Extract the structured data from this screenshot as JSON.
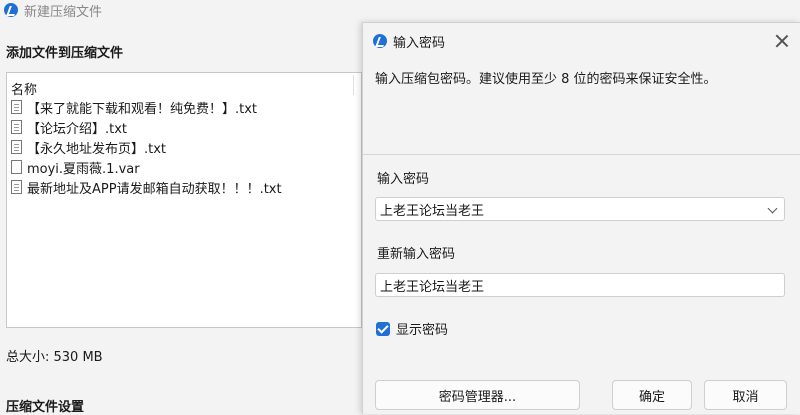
{
  "background_window": {
    "title": "新建压缩文件",
    "heading": "添加文件到压缩文件",
    "list_header": "名称",
    "files": [
      {
        "name": "【来了就能下载和观看！纯免费！】.txt",
        "icon": "text-file-icon"
      },
      {
        "name": "【论坛介绍】.txt",
        "icon": "text-file-icon"
      },
      {
        "name": "【永久地址发布页】.txt",
        "icon": "text-file-icon"
      },
      {
        "name": "moyi.夏雨薇.1.var",
        "icon": "blank-file-icon"
      },
      {
        "name": "最新地址及APP请发邮箱自动获取！！！.txt",
        "icon": "text-file-icon"
      }
    ],
    "total_size": "总大小: 530 MB",
    "settings_heading": "压缩文件设置"
  },
  "dialog": {
    "title": "输入密码",
    "description": "输入压缩包密码。建议使用至少 8 位的密码来保证安全性。",
    "password_label": "输入密码",
    "password_value": "上老王论坛当老王",
    "confirm_label": "重新输入密码",
    "confirm_value": "上老王论坛当老王",
    "show_password_label": "显示密码",
    "show_password_checked": true,
    "buttons": {
      "manager": "密码管理器...",
      "ok": "确定",
      "cancel": "取消"
    }
  },
  "colors": {
    "accent": "#1f6fd6"
  }
}
